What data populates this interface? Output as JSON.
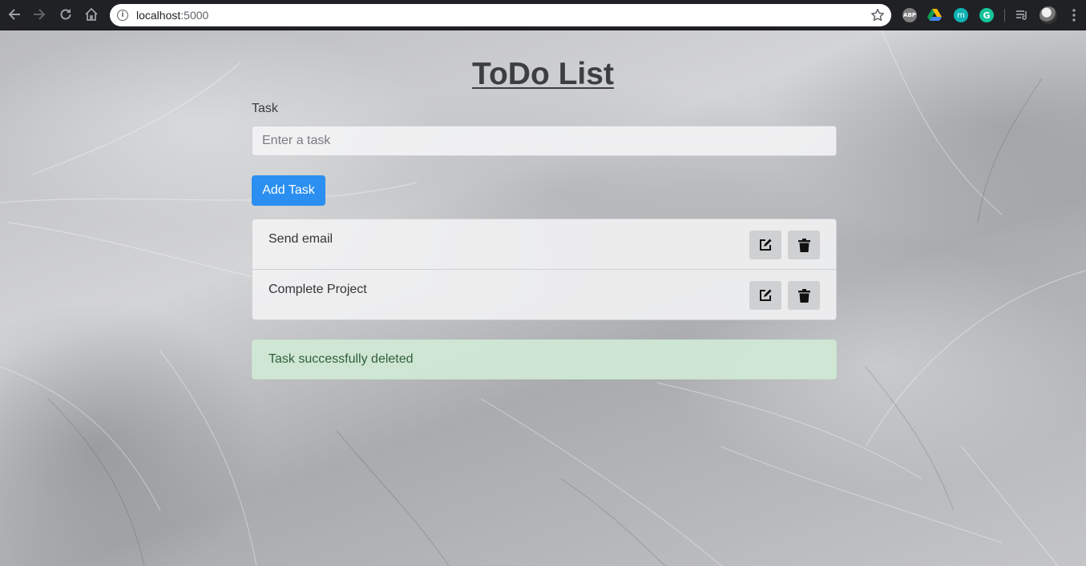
{
  "browser": {
    "url_host": "localhost",
    "url_port": ":5000",
    "extensions": [
      {
        "name": "adblock-plus",
        "label": "ABP"
      },
      {
        "name": "google-drive",
        "label": ""
      },
      {
        "name": "m-extension",
        "label": "m"
      },
      {
        "name": "grammarly",
        "label": "G"
      }
    ]
  },
  "app": {
    "title": "ToDo List",
    "task_label": "Task",
    "task_input": {
      "placeholder": "Enter a task",
      "value": ""
    },
    "add_button_label": "Add Task",
    "tasks": [
      {
        "text": "Send email"
      },
      {
        "text": "Complete Project"
      }
    ],
    "alert": {
      "text": "Task successfully deleted",
      "color": "#d0e9d6"
    }
  },
  "colors": {
    "primary_button": "#2a8ff0",
    "icon_button_bg": "#cfd0d2",
    "chrome_bg": "#202124"
  },
  "icons": {
    "back": "arrow-left-icon",
    "forward": "arrow-right-icon",
    "reload": "reload-icon",
    "home": "home-icon",
    "info": "info-icon",
    "bookmark": "star-icon",
    "edit": "edit-icon",
    "delete": "trash-icon"
  }
}
